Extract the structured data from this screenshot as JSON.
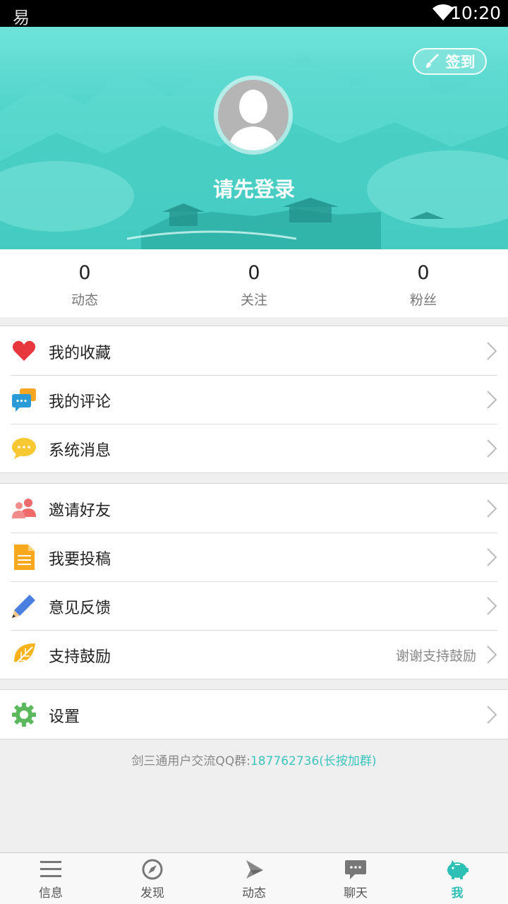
{
  "status_bar": {
    "app_glyph": "易",
    "time": "10:20"
  },
  "header": {
    "signin_label": "签到",
    "login_prompt": "请先登录"
  },
  "stats": [
    {
      "value": "0",
      "label": "动态"
    },
    {
      "value": "0",
      "label": "关注"
    },
    {
      "value": "0",
      "label": "粉丝"
    }
  ],
  "menu": {
    "group1": [
      {
        "label": "我的收藏",
        "icon": "heart-icon"
      },
      {
        "label": "我的评论",
        "icon": "comments-icon"
      },
      {
        "label": "系统消息",
        "icon": "message-bubble-icon"
      }
    ],
    "group2": [
      {
        "label": "邀请好友",
        "icon": "people-icon"
      },
      {
        "label": "我要投稿",
        "icon": "document-icon"
      },
      {
        "label": "意见反馈",
        "icon": "pencil-icon"
      },
      {
        "label": "支持鼓励",
        "icon": "leaf-icon",
        "hint": "谢谢支持鼓励"
      }
    ],
    "group3": [
      {
        "label": "设置",
        "icon": "gear-icon"
      }
    ]
  },
  "footer_note": {
    "prefix": "剑三通用户交流QQ群:",
    "qq": "187762736(长按加群)"
  },
  "tabs": [
    {
      "label": "信息",
      "icon": "list-icon",
      "active": false
    },
    {
      "label": "发现",
      "icon": "compass-icon",
      "active": false
    },
    {
      "label": "动态",
      "icon": "paper-plane-icon",
      "active": false
    },
    {
      "label": "聊天",
      "icon": "chat-icon",
      "active": false
    },
    {
      "label": "我",
      "icon": "piggy-icon",
      "active": true
    }
  ],
  "colors": {
    "accent": "#2ec0b6",
    "header_teal": "#4fd3c9"
  }
}
